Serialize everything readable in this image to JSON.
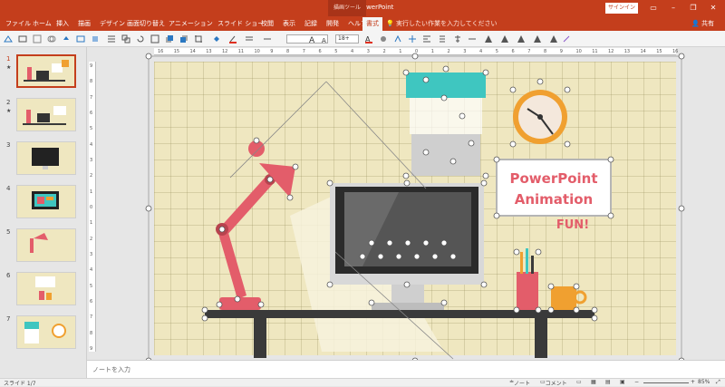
{
  "titlebar": {
    "title": "Desk+  -  PowerPoint",
    "context_tab": "描画ツール",
    "signin": "サインイン"
  },
  "ribbon": {
    "tabs": [
      "ファイル",
      "ホーム",
      "挿入",
      "描画",
      "デザイン",
      "画面切り替え",
      "アニメーション",
      "スライド ショー",
      "校閲",
      "表示",
      "記録",
      "開発",
      "ヘルプ",
      "書式"
    ],
    "active_tab": "書式",
    "tell_me": "実行したい作業を入力してください",
    "share": "共有"
  },
  "toolbar": {
    "font_size": "18+"
  },
  "thumbnails": [
    {
      "num": "1",
      "star": "★",
      "active": true
    },
    {
      "num": "2",
      "star": "★",
      "active": false
    },
    {
      "num": "3",
      "star": "",
      "active": false
    },
    {
      "num": "4",
      "star": "",
      "active": false
    },
    {
      "num": "5",
      "star": "",
      "active": false
    },
    {
      "num": "6",
      "star": "",
      "active": false
    },
    {
      "num": "7",
      "star": "",
      "active": false
    }
  ],
  "ruler": {
    "h_labels": [
      "16",
      "15",
      "14",
      "13",
      "12",
      "11",
      "10",
      "9",
      "8",
      "7",
      "6",
      "5",
      "4",
      "3",
      "2",
      "1",
      "0",
      "1",
      "2",
      "3",
      "4",
      "5",
      "6",
      "7",
      "8",
      "9",
      "10",
      "11",
      "12",
      "13",
      "14",
      "15",
      "16"
    ],
    "v_labels": [
      "9",
      "8",
      "7",
      "6",
      "5",
      "4",
      "3",
      "2",
      "1",
      "0",
      "1",
      "2",
      "3",
      "4",
      "5",
      "6",
      "7",
      "8",
      "9"
    ]
  },
  "slide": {
    "sign_line1": "PowerPoint",
    "sign_line2": "Animation",
    "sign_line3": "FUN!",
    "colors": {
      "background": "#efe7c0",
      "lamp": "#e35d6a",
      "desk": "#3a3a3a",
      "teal": "#3fc6c0",
      "clock": "#f0a030",
      "sign_text": "#e35d6a"
    }
  },
  "notes": {
    "placeholder": "ノートを入力"
  },
  "status": {
    "slide_info": "スライド 1/7",
    "notes_btn": "ノート",
    "comments_btn": "コメント",
    "zoom": "85%"
  }
}
